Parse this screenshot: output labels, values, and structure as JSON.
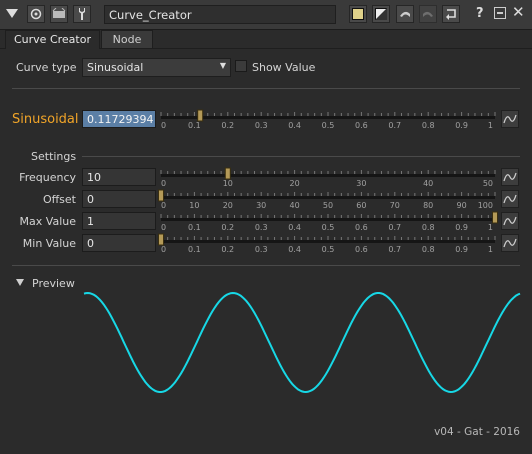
{
  "toolbar": {
    "node_name": "Curve_Creator",
    "icons": [
      "menu-arrow-icon",
      "circle-target-icon",
      "grid-icon",
      "wrench-icon",
      "color-swatch-icon",
      "slash-box-icon",
      "undo-icon",
      "redo-icon",
      "revert-icon",
      "help-icon",
      "minimize-icon",
      "close-icon"
    ],
    "help_label": "?"
  },
  "tabs": [
    {
      "label": "Curve Creator",
      "active": true
    },
    {
      "label": "Node",
      "active": false
    }
  ],
  "curve_type": {
    "label": "Curve type",
    "selected": "Sinusoidal",
    "show_value_label": "Show Value",
    "show_value_checked": false
  },
  "main_knob": {
    "label": "Sinusoidal",
    "value": "0.11729394",
    "slider_position": 0.1173,
    "ticks": [
      "0",
      "0.1",
      "0.2",
      "0.3",
      "0.4",
      "0.5",
      "0.6",
      "0.7",
      "0.8",
      "0.9",
      "1"
    ]
  },
  "settings": {
    "title": "Settings",
    "frequency": {
      "label": "Frequency",
      "value": "10",
      "ticks": [
        "0",
        "10",
        "20",
        "30",
        "40",
        "50"
      ],
      "slider_position": 0.2
    },
    "offset": {
      "label": "Offset",
      "value": "0",
      "ticks": [
        "0",
        "10",
        "20",
        "30",
        "40",
        "50",
        "60",
        "70",
        "80",
        "90",
        "100"
      ],
      "slider_position": 0.0
    },
    "max_value": {
      "label": "Max Value",
      "value": "1",
      "ticks": [
        "0",
        "0.1",
        "0.2",
        "0.3",
        "0.4",
        "0.5",
        "0.6",
        "0.7",
        "0.8",
        "0.9",
        "1"
      ],
      "slider_position": 1.0
    },
    "min_value": {
      "label": "Min Value",
      "value": "0",
      "ticks": [
        "0",
        "0.1",
        "0.2",
        "0.3",
        "0.4",
        "0.5",
        "0.6",
        "0.7",
        "0.8",
        "0.9",
        "1"
      ],
      "slider_position": 0.0
    }
  },
  "preview": {
    "label": "Preview",
    "curve_color": "#17d8e6",
    "cycles": 3
  },
  "credit": "v04 - Gat - 2016",
  "colors": {
    "accent_orange": "#f0a428",
    "value_highlight": "#5b7fa6",
    "background": "#2b2b2b"
  }
}
